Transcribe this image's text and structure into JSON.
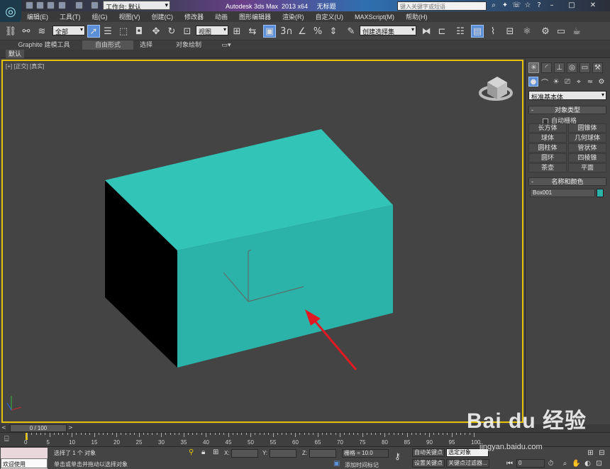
{
  "title_bar": {
    "workspace_label": "工作台: 默认",
    "app_title": "Autodesk 3ds Max  2013 x64     无标题",
    "search_placeholder": "键入关键字或短语"
  },
  "menu": [
    "编辑(E)",
    "工具(T)",
    "组(G)",
    "视图(V)",
    "创建(C)",
    "修改器",
    "动画",
    "图形编辑器",
    "渲染(R)",
    "自定义(U)",
    "MAXScript(M)",
    "帮助(H)"
  ],
  "toolbar": {
    "filter_select": "全部",
    "refcoord_select": "视图",
    "named_selection": "创建选择集",
    "snap_label": "3"
  },
  "ribbon": {
    "tabs": [
      "Graphite 建模工具",
      "自由形式",
      "选择",
      "对象绘制"
    ],
    "active_tab": "自由形式",
    "sub_tab": "默认"
  },
  "viewport": {
    "label": "[+] [正交] [真实]",
    "box_color": "#2bb3a9",
    "box_top_color": "#33c4b8",
    "box_front_color": "#27a89e",
    "arrow_color": "#e01a22"
  },
  "command_panel": {
    "category_dropdown": "标准基本体",
    "object_type_header": "对象类型",
    "autogrid_label": "自动栅格",
    "object_buttons": [
      "长方体",
      "圆锥体",
      "球体",
      "几何球体",
      "圆柱体",
      "管状体",
      "圆环",
      "四棱锥",
      "茶壶",
      "平面"
    ],
    "name_color_header": "名称和颜色",
    "object_name": "Box001",
    "object_color": "#2bb3a9"
  },
  "timeline": {
    "frame_indicator": "0 / 100",
    "ticks": [
      "0",
      "5",
      "10",
      "15",
      "20",
      "25",
      "30",
      "35",
      "40",
      "45",
      "50",
      "55",
      "60",
      "65",
      "70",
      "75",
      "80",
      "85",
      "90",
      "95",
      "100"
    ]
  },
  "status_bar": {
    "welcome": "欢迎使用 MAXSc",
    "selection_status": "选择了 1 个 对象",
    "prompt": "单击或单击并拖动以选择对象",
    "x_label": "X:",
    "y_label": "Y:",
    "z_label": "Z:",
    "grid_label": "栅格 = 10.0",
    "add_time_tag": "添加时间标记",
    "auto_key": "自动关键点",
    "selected_object": "选定对象",
    "set_key": "设置关键点",
    "key_filters": "关键点过滤器...",
    "frame_value": "0"
  },
  "watermark": {
    "logo": "Bai du 经验",
    "url": "jingyan.baidu.com"
  }
}
